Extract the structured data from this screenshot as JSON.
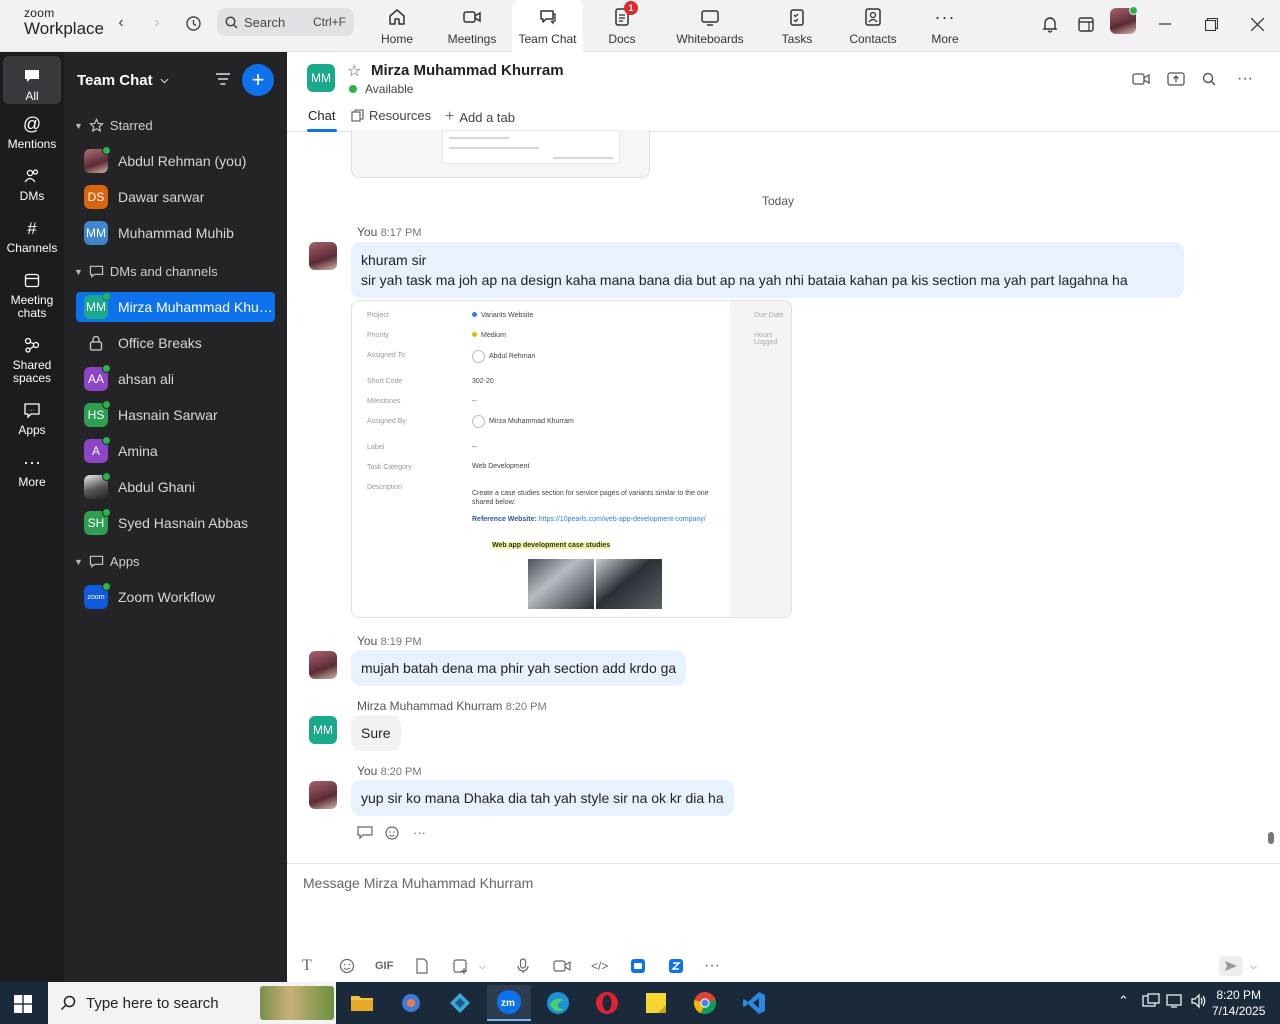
{
  "app": {
    "logo_line1": "zoom",
    "logo_line2": "Workplace",
    "search_label": "Search",
    "search_shortcut": "Ctrl+F"
  },
  "nav_tabs": [
    {
      "label": "Home",
      "icon": "home-icon"
    },
    {
      "label": "Meetings",
      "icon": "video-icon"
    },
    {
      "label": "Team Chat",
      "icon": "chat-icon",
      "active": true
    },
    {
      "label": "Docs",
      "icon": "docs-icon",
      "badge": "1"
    },
    {
      "label": "Whiteboards",
      "icon": "whiteboard-icon"
    },
    {
      "label": "Tasks",
      "icon": "tasks-icon"
    },
    {
      "label": "Contacts",
      "icon": "contacts-icon"
    },
    {
      "label": "More",
      "icon": "more-icon"
    }
  ],
  "rail": [
    {
      "label": "All",
      "icon": "chat-bubble-icon",
      "active": true
    },
    {
      "label": "Mentions",
      "icon": "at-icon"
    },
    {
      "label": "DMs",
      "icon": "people-icon"
    },
    {
      "label": "Channels",
      "icon": "hash-icon"
    },
    {
      "label": "Meeting chats",
      "icon": "calendar-icon"
    },
    {
      "label": "Shared spaces",
      "icon": "shared-icon"
    },
    {
      "label": "Apps",
      "icon": "apps-icon"
    },
    {
      "label": "More",
      "icon": "ellipsis-icon"
    }
  ],
  "sidebar": {
    "title": "Team Chat",
    "sections": {
      "starred": "Starred",
      "dms": "DMs and channels",
      "apps": "Apps"
    },
    "starred": [
      {
        "name": "Abdul Rehman (you)",
        "initials": "",
        "color": "#8d5a5f",
        "photo": true,
        "online": true
      },
      {
        "name": "Dawar sarwar",
        "initials": "DS",
        "color": "#d9660f"
      },
      {
        "name": "Muhammad Muhib",
        "initials": "MM",
        "color": "#3f87c9"
      }
    ],
    "dms": [
      {
        "name": "Mirza Muhammad Khurram",
        "initials": "MM",
        "color": "#1aa98a",
        "online": true,
        "selected": true
      },
      {
        "name": "Office Breaks",
        "initials": "",
        "color": "",
        "lock": true
      },
      {
        "name": "ahsan ali",
        "initials": "AA",
        "color": "#8b45c6",
        "online": true
      },
      {
        "name": "Hasnain Sarwar",
        "initials": "HS",
        "color": "#2e9e50",
        "online": true
      },
      {
        "name": "Amina",
        "initials": "A",
        "color": "#8b45c6",
        "online": true
      },
      {
        "name": "Abdul Ghani",
        "initials": "",
        "color": "#dcdcdc",
        "photo": true,
        "online": true
      },
      {
        "name": "Syed Hasnain Abbas",
        "initials": "SH",
        "color": "#2e9e50",
        "online": true
      }
    ],
    "apps": [
      {
        "name": "Zoom Workflow",
        "initials": "zoom",
        "color": "#0e5be0",
        "online": true
      }
    ]
  },
  "chat": {
    "contact_initials": "MM",
    "contact_name": "Mirza Muhammad Khurram",
    "status": "Available",
    "tabs": [
      "Chat",
      "Resources",
      "Add a tab"
    ],
    "date_separator": "Today",
    "messages": [
      {
        "sender": "You",
        "time": "8:17 PM",
        "line1": "khuram sir",
        "line2": "sir yah task ma joh ap na design kaha mana bana dia but ap na yah nhi bataia kahan pa kis section ma yah part lagahna ha"
      },
      {
        "sender": "You",
        "time": "8:19 PM",
        "text": "mujah batah dena ma phir yah section add krdo ga"
      },
      {
        "sender": "Mirza Muhammad Khurram",
        "time": "8:20 PM",
        "text": "Sure"
      },
      {
        "sender": "You",
        "time": "8:20 PM",
        "text": "yup sir ko mana Dhaka dia tah yah style sir na ok kr dia ha"
      }
    ],
    "attachment": {
      "fields": [
        {
          "label": "Project",
          "value": "Variants Website",
          "dot": "#2f7fe0"
        },
        {
          "label": "Priority",
          "value": "Medium",
          "dot": "#e6b800"
        },
        {
          "label": "Assigned To",
          "value": "Abdul Rehman"
        },
        {
          "label": "Short Code",
          "value": "302-20"
        },
        {
          "label": "Milestones",
          "value": "--"
        },
        {
          "label": "Assigned By",
          "value": "Mirza Muhammad Khurram"
        },
        {
          "label": "Label",
          "value": "--"
        },
        {
          "label": "Task Category",
          "value": "Web Development"
        },
        {
          "label": "Description",
          "value": "Create a case studies section for service pages of variants similar to the one shared below:"
        }
      ],
      "reference_label": "Reference Website:",
      "reference_url": "https://10pearls.com/web-app-development-company/",
      "highlight": "Web app development case studies",
      "side_labels": [
        "Due Date",
        "Hours Logged"
      ]
    },
    "composer_placeholder": "Message Mirza Muhammad Khurram",
    "composer_gif": "GIF"
  },
  "taskbar": {
    "search_placeholder": "Type here to search",
    "time": "8:20 PM",
    "date": "7/14/2025"
  }
}
